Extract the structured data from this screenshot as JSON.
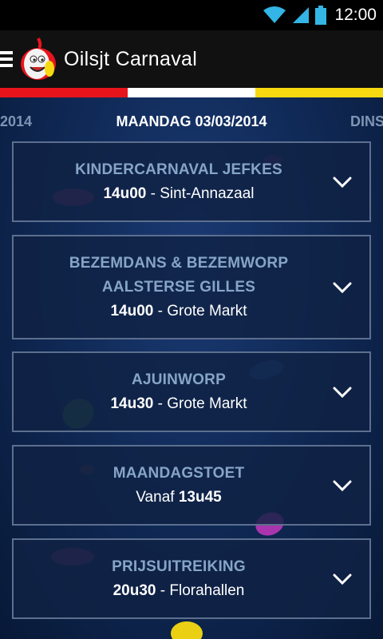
{
  "status_bar": {
    "time": "12:00",
    "icons": [
      "wifi-icon",
      "signal-icon",
      "battery-icon"
    ]
  },
  "action_bar": {
    "title": "Oilsjt Carnaval",
    "icons": [
      "menu-icon",
      "onion-logo"
    ]
  },
  "flag_colors": [
    "#e8141c",
    "#ffffff",
    "#f7d911"
  ],
  "tabs": {
    "previous": "2014",
    "current": "MAANDAG 03/03/2014",
    "next": "DINS"
  },
  "events": [
    {
      "title_lines": [
        "KINDERCARNAVAL JEFKES"
      ],
      "prefix": "",
      "time": "14u00",
      "separator": " - ",
      "location": "Sint-Annazaal"
    },
    {
      "title_lines": [
        "BEZEMDANS & BEZEMWORP",
        "AALSTERSE GILLES"
      ],
      "prefix": "",
      "time": "14u00",
      "separator": " - ",
      "location": "Grote Markt"
    },
    {
      "title_lines": [
        "AJUINWORP"
      ],
      "prefix": "",
      "time": "14u30",
      "separator": " - ",
      "location": "Grote Markt"
    },
    {
      "title_lines": [
        "MAANDAGSTOET"
      ],
      "prefix": "Vanaf ",
      "time": "13u45",
      "separator": "",
      "location": ""
    },
    {
      "title_lines": [
        "PRIJSUITREIKING"
      ],
      "prefix": "",
      "time": "20u30",
      "separator": " - ",
      "location": "Florahallen"
    }
  ],
  "colors": {
    "card_title": "#86a5c6",
    "card_border": "#5c6f8e",
    "background": "#102a58"
  }
}
